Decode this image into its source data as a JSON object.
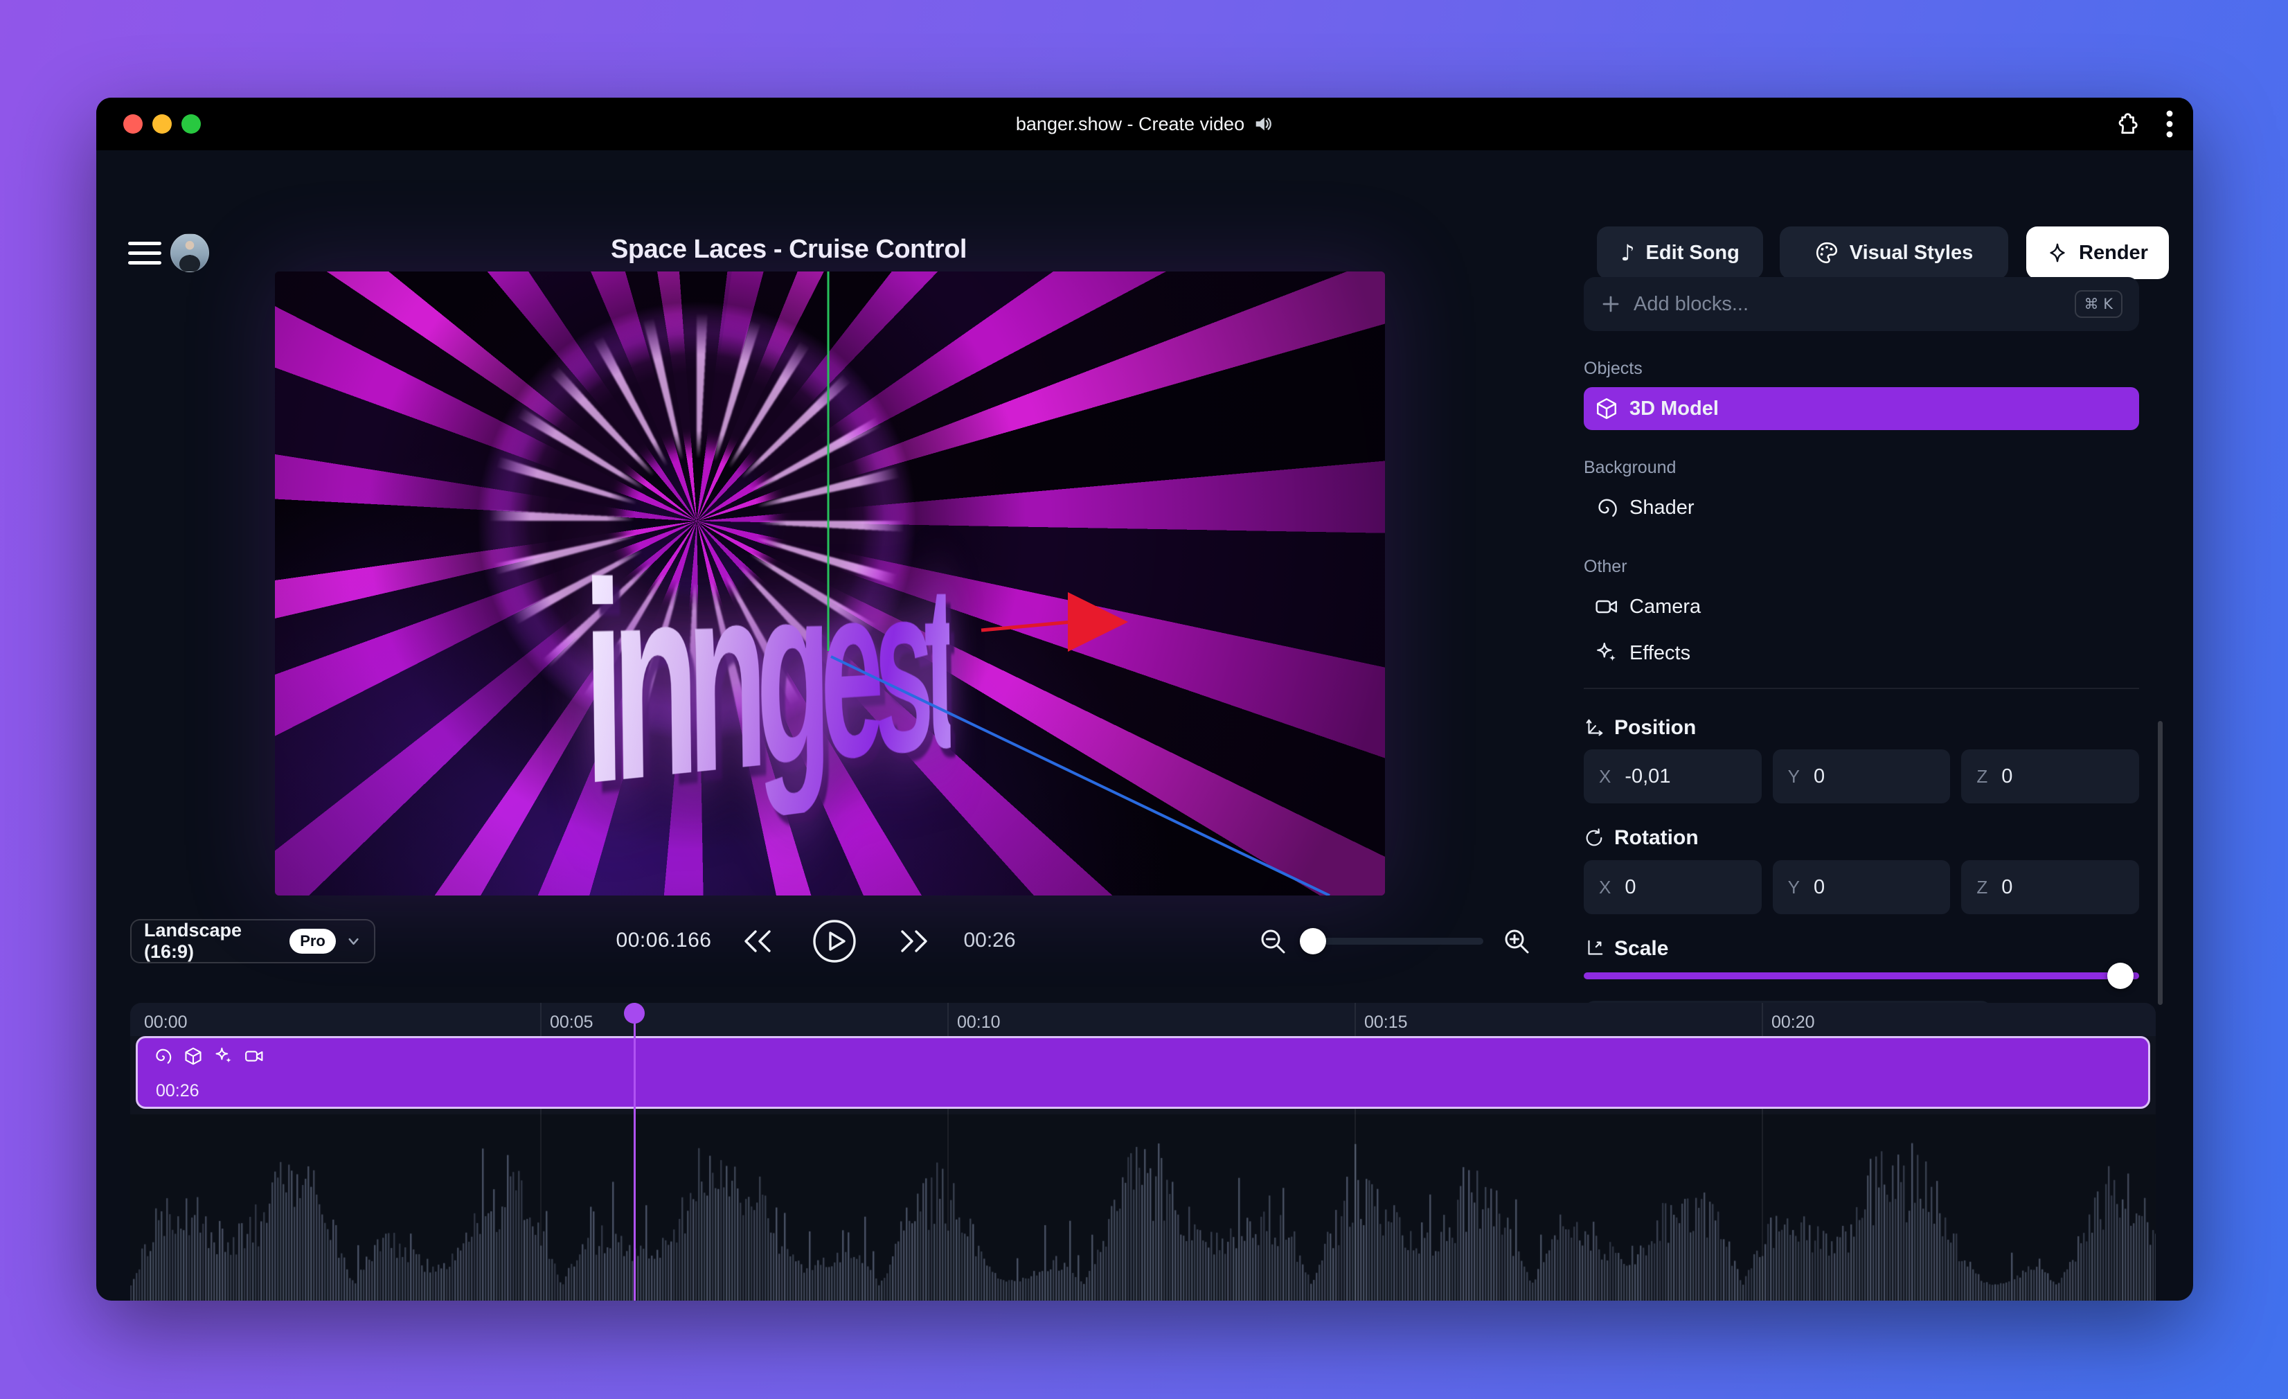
{
  "titlebar": {
    "title": "banger.show - Create video"
  },
  "header": {
    "project_title": "Space Laces - Cruise Control",
    "edit_song_label": "Edit Song",
    "visual_styles_label": "Visual Styles",
    "render_label": "Render"
  },
  "preview": {
    "logo_text": "inngest"
  },
  "controls": {
    "aspect_label": "Landscape (16:9)",
    "pro_badge": "Pro",
    "current_time": "00:06.166",
    "duration": "00:26"
  },
  "sidebar": {
    "add_blocks": {
      "placeholder": "Add blocks...",
      "shortcut": "⌘ K"
    },
    "groups": [
      {
        "label": "Objects",
        "items": [
          {
            "label": "3D Model",
            "icon": "cube-icon",
            "selected": true
          }
        ]
      },
      {
        "label": "Background",
        "items": [
          {
            "label": "Shader",
            "icon": "shader-icon"
          }
        ]
      },
      {
        "label": "Other",
        "items": [
          {
            "label": "Camera",
            "icon": "camera-icon"
          },
          {
            "label": "Effects",
            "icon": "effects-icon"
          }
        ]
      }
    ],
    "transform": {
      "position": {
        "title": "Position",
        "fields": [
          {
            "axis": "X",
            "value": "-0,01"
          },
          {
            "axis": "Y",
            "value": "0"
          },
          {
            "axis": "Z",
            "value": "0"
          }
        ]
      },
      "rotation": {
        "title": "Rotation",
        "fields": [
          {
            "axis": "X",
            "value": "0"
          },
          {
            "axis": "Y",
            "value": "0"
          },
          {
            "axis": "Z",
            "value": "0"
          }
        ]
      },
      "scale": {
        "title": "Scale",
        "value_percent": 100
      }
    }
  },
  "timeline": {
    "ticks": [
      "00:00",
      "00:05",
      "00:10",
      "00:15",
      "00:20"
    ],
    "clip": {
      "duration": "00:26",
      "icons": [
        "shader-icon",
        "cube-icon",
        "effects-icon",
        "camera-icon"
      ]
    },
    "playhead_time": "00:06.166"
  },
  "colors": {
    "accent_purple": "#8e2be1",
    "clip_purple": "#8a27da",
    "playhead_purple": "#a649ef",
    "desktop_gradient_from": "#9156e9",
    "desktop_gradient_to": "#4171ee",
    "traffic_red": "#ff5f57",
    "traffic_yellow": "#febc2e",
    "traffic_green": "#28c840"
  }
}
